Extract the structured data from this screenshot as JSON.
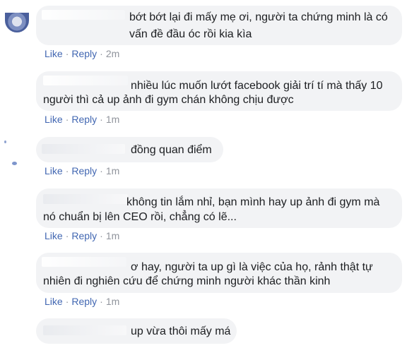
{
  "comments": [
    {
      "lines": [
        "bớt bớt lại đi mấy mẹ ơi, người ta chứng minh là có",
        "vấn đề đầu óc rồi kia kìa"
      ],
      "like": "Like",
      "reply": "Reply",
      "time": "2m"
    },
    {
      "lines": [
        "nhiều lúc muốn lướt facebook giải trí tí mà thấy 10",
        "người thì cả up ảnh đi gym chán không chịu được"
      ],
      "like": "Like",
      "reply": "Reply",
      "time": "1m"
    },
    {
      "lines": [
        "đồng quan điểm"
      ],
      "like": "Like",
      "reply": "Reply",
      "time": "1m"
    },
    {
      "lines": [
        "không tin lắm nhỉ, bạn mình hay up ảnh đi gym mà",
        "nó chuẩn bị lên CEO rồi, chẳng có lẽ..."
      ],
      "like": "Like",
      "reply": "Reply",
      "time": "1m"
    },
    {
      "lines": [
        "ơ hay, người ta up gì là việc của họ, rảnh thật tự",
        "nhiên đi nghiên cứu để chứng minh người khác thần kinh"
      ],
      "like": "Like",
      "reply": "Reply",
      "time": "1m"
    },
    {
      "lines": [
        "up vừa thôi mấy má"
      ]
    }
  ],
  "separator": "·",
  "colors": {
    "bubble": "#f2f3f5",
    "link": "#4267b2",
    "meta": "#90949c",
    "text": "#1c1e21"
  }
}
